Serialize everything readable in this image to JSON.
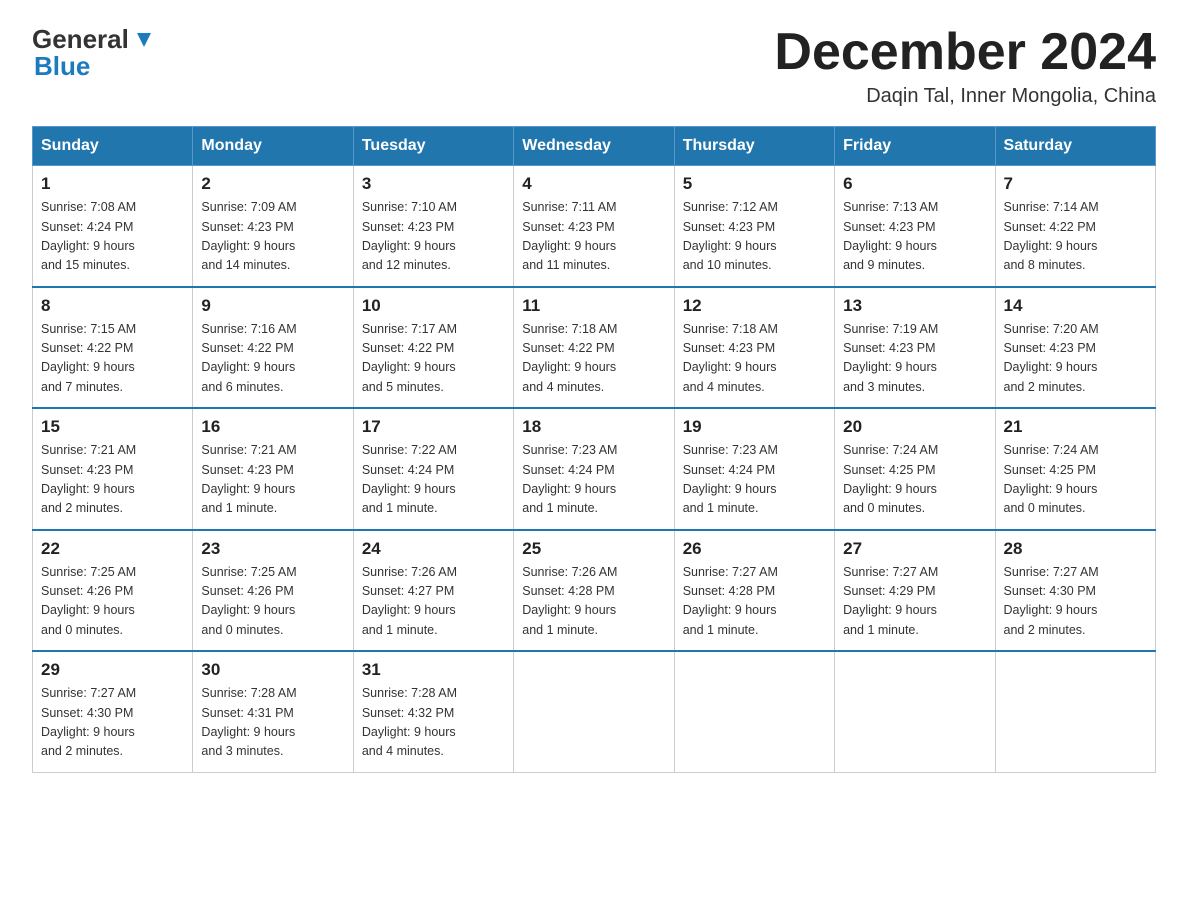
{
  "header": {
    "logo_line1": "General",
    "logo_line2": "Blue",
    "month_title": "December 2024",
    "location": "Daqin Tal, Inner Mongolia, China"
  },
  "days_of_week": [
    "Sunday",
    "Monday",
    "Tuesday",
    "Wednesday",
    "Thursday",
    "Friday",
    "Saturday"
  ],
  "weeks": [
    [
      {
        "day": "1",
        "sunrise": "7:08 AM",
        "sunset": "4:24 PM",
        "daylight": "9 hours and 15 minutes."
      },
      {
        "day": "2",
        "sunrise": "7:09 AM",
        "sunset": "4:23 PM",
        "daylight": "9 hours and 14 minutes."
      },
      {
        "day": "3",
        "sunrise": "7:10 AM",
        "sunset": "4:23 PM",
        "daylight": "9 hours and 12 minutes."
      },
      {
        "day": "4",
        "sunrise": "7:11 AM",
        "sunset": "4:23 PM",
        "daylight": "9 hours and 11 minutes."
      },
      {
        "day": "5",
        "sunrise": "7:12 AM",
        "sunset": "4:23 PM",
        "daylight": "9 hours and 10 minutes."
      },
      {
        "day": "6",
        "sunrise": "7:13 AM",
        "sunset": "4:23 PM",
        "daylight": "9 hours and 9 minutes."
      },
      {
        "day": "7",
        "sunrise": "7:14 AM",
        "sunset": "4:22 PM",
        "daylight": "9 hours and 8 minutes."
      }
    ],
    [
      {
        "day": "8",
        "sunrise": "7:15 AM",
        "sunset": "4:22 PM",
        "daylight": "9 hours and 7 minutes."
      },
      {
        "day": "9",
        "sunrise": "7:16 AM",
        "sunset": "4:22 PM",
        "daylight": "9 hours and 6 minutes."
      },
      {
        "day": "10",
        "sunrise": "7:17 AM",
        "sunset": "4:22 PM",
        "daylight": "9 hours and 5 minutes."
      },
      {
        "day": "11",
        "sunrise": "7:18 AM",
        "sunset": "4:22 PM",
        "daylight": "9 hours and 4 minutes."
      },
      {
        "day": "12",
        "sunrise": "7:18 AM",
        "sunset": "4:23 PM",
        "daylight": "9 hours and 4 minutes."
      },
      {
        "day": "13",
        "sunrise": "7:19 AM",
        "sunset": "4:23 PM",
        "daylight": "9 hours and 3 minutes."
      },
      {
        "day": "14",
        "sunrise": "7:20 AM",
        "sunset": "4:23 PM",
        "daylight": "9 hours and 2 minutes."
      }
    ],
    [
      {
        "day": "15",
        "sunrise": "7:21 AM",
        "sunset": "4:23 PM",
        "daylight": "9 hours and 2 minutes."
      },
      {
        "day": "16",
        "sunrise": "7:21 AM",
        "sunset": "4:23 PM",
        "daylight": "9 hours and 1 minute."
      },
      {
        "day": "17",
        "sunrise": "7:22 AM",
        "sunset": "4:24 PM",
        "daylight": "9 hours and 1 minute."
      },
      {
        "day": "18",
        "sunrise": "7:23 AM",
        "sunset": "4:24 PM",
        "daylight": "9 hours and 1 minute."
      },
      {
        "day": "19",
        "sunrise": "7:23 AM",
        "sunset": "4:24 PM",
        "daylight": "9 hours and 1 minute."
      },
      {
        "day": "20",
        "sunrise": "7:24 AM",
        "sunset": "4:25 PM",
        "daylight": "9 hours and 0 minutes."
      },
      {
        "day": "21",
        "sunrise": "7:24 AM",
        "sunset": "4:25 PM",
        "daylight": "9 hours and 0 minutes."
      }
    ],
    [
      {
        "day": "22",
        "sunrise": "7:25 AM",
        "sunset": "4:26 PM",
        "daylight": "9 hours and 0 minutes."
      },
      {
        "day": "23",
        "sunrise": "7:25 AM",
        "sunset": "4:26 PM",
        "daylight": "9 hours and 0 minutes."
      },
      {
        "day": "24",
        "sunrise": "7:26 AM",
        "sunset": "4:27 PM",
        "daylight": "9 hours and 1 minute."
      },
      {
        "day": "25",
        "sunrise": "7:26 AM",
        "sunset": "4:28 PM",
        "daylight": "9 hours and 1 minute."
      },
      {
        "day": "26",
        "sunrise": "7:27 AM",
        "sunset": "4:28 PM",
        "daylight": "9 hours and 1 minute."
      },
      {
        "day": "27",
        "sunrise": "7:27 AM",
        "sunset": "4:29 PM",
        "daylight": "9 hours and 1 minute."
      },
      {
        "day": "28",
        "sunrise": "7:27 AM",
        "sunset": "4:30 PM",
        "daylight": "9 hours and 2 minutes."
      }
    ],
    [
      {
        "day": "29",
        "sunrise": "7:27 AM",
        "sunset": "4:30 PM",
        "daylight": "9 hours and 2 minutes."
      },
      {
        "day": "30",
        "sunrise": "7:28 AM",
        "sunset": "4:31 PM",
        "daylight": "9 hours and 3 minutes."
      },
      {
        "day": "31",
        "sunrise": "7:28 AM",
        "sunset": "4:32 PM",
        "daylight": "9 hours and 4 minutes."
      },
      null,
      null,
      null,
      null
    ]
  ],
  "labels": {
    "sunrise_prefix": "Sunrise: ",
    "sunset_prefix": "Sunset: ",
    "daylight_prefix": "Daylight: "
  }
}
